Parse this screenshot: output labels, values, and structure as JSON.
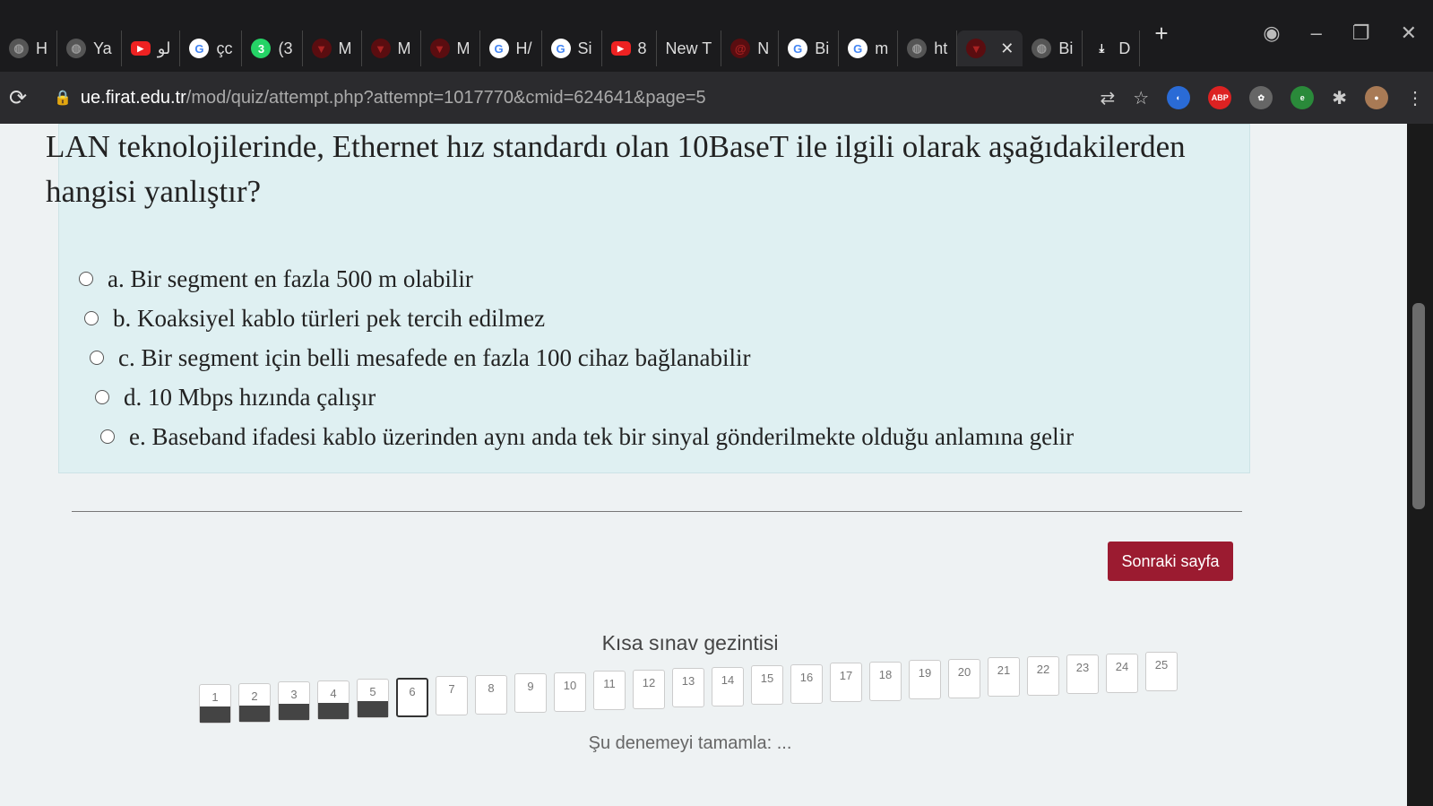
{
  "browser": {
    "tabs": [
      {
        "icon": "globe",
        "label": "H"
      },
      {
        "icon": "globe",
        "label": "Ya"
      },
      {
        "icon": "youtube",
        "label": "ﻟﻮ"
      },
      {
        "icon": "google",
        "label": "çc"
      },
      {
        "icon": "whatsapp",
        "label": "(3",
        "badge": "3"
      },
      {
        "icon": "red-logo",
        "label": "M"
      },
      {
        "icon": "red-logo",
        "label": "M"
      },
      {
        "icon": "red-logo",
        "label": "M"
      },
      {
        "icon": "google",
        "label": "H/"
      },
      {
        "icon": "google",
        "label": "Si"
      },
      {
        "icon": "youtube",
        "label": "8"
      },
      {
        "icon": "none",
        "label": "New T"
      },
      {
        "icon": "swirl",
        "label": "N"
      },
      {
        "icon": "google",
        "label": "Bi"
      },
      {
        "icon": "google",
        "label": "m"
      },
      {
        "icon": "globe",
        "label": "ht"
      },
      {
        "icon": "red-logo",
        "label": "",
        "active": true,
        "close": "✕"
      },
      {
        "icon": "globe",
        "label": "Bi"
      },
      {
        "icon": "download",
        "label": "D"
      }
    ],
    "new_tab": "+",
    "url_host": "ue.firat.edu.tr",
    "url_rest": "/mod/quiz/attempt.php?attempt=1017770&cmid=624641&page=5"
  },
  "question": {
    "text": "LAN teknolojilerinde, Ethernet hız standardı olan 10BaseT ile ilgili olarak aşağıdakilerden hangisi yanlıştır?",
    "options": [
      "a. Bir segment en fazla 500 m olabilir",
      "b. Koaksiyel kablo türleri pek tercih edilmez",
      "c. Bir segment için belli mesafede en fazla 100 cihaz bağlanabilir",
      "d. 10 Mbps hızında çalışır",
      "e. Baseband ifadesi kablo üzerinden aynı anda tek bir sinyal gönderilmekte olduğu anlamına gelir"
    ]
  },
  "next_button": "Sonraki sayfa",
  "nav": {
    "title": "Kısa sınav gezintisi",
    "pages": [
      "1",
      "2",
      "3",
      "4",
      "5",
      "6",
      "7",
      "8",
      "9",
      "10",
      "11",
      "12",
      "13",
      "14",
      "15",
      "16",
      "17",
      "18",
      "19",
      "20",
      "21",
      "22",
      "23",
      "24",
      "25"
    ],
    "answered": 5,
    "current": "6",
    "finish": "Şu denemeyi tamamla: ..."
  },
  "colors": {
    "accent": "#9b1b30",
    "question_bg": "#dff0f2"
  }
}
